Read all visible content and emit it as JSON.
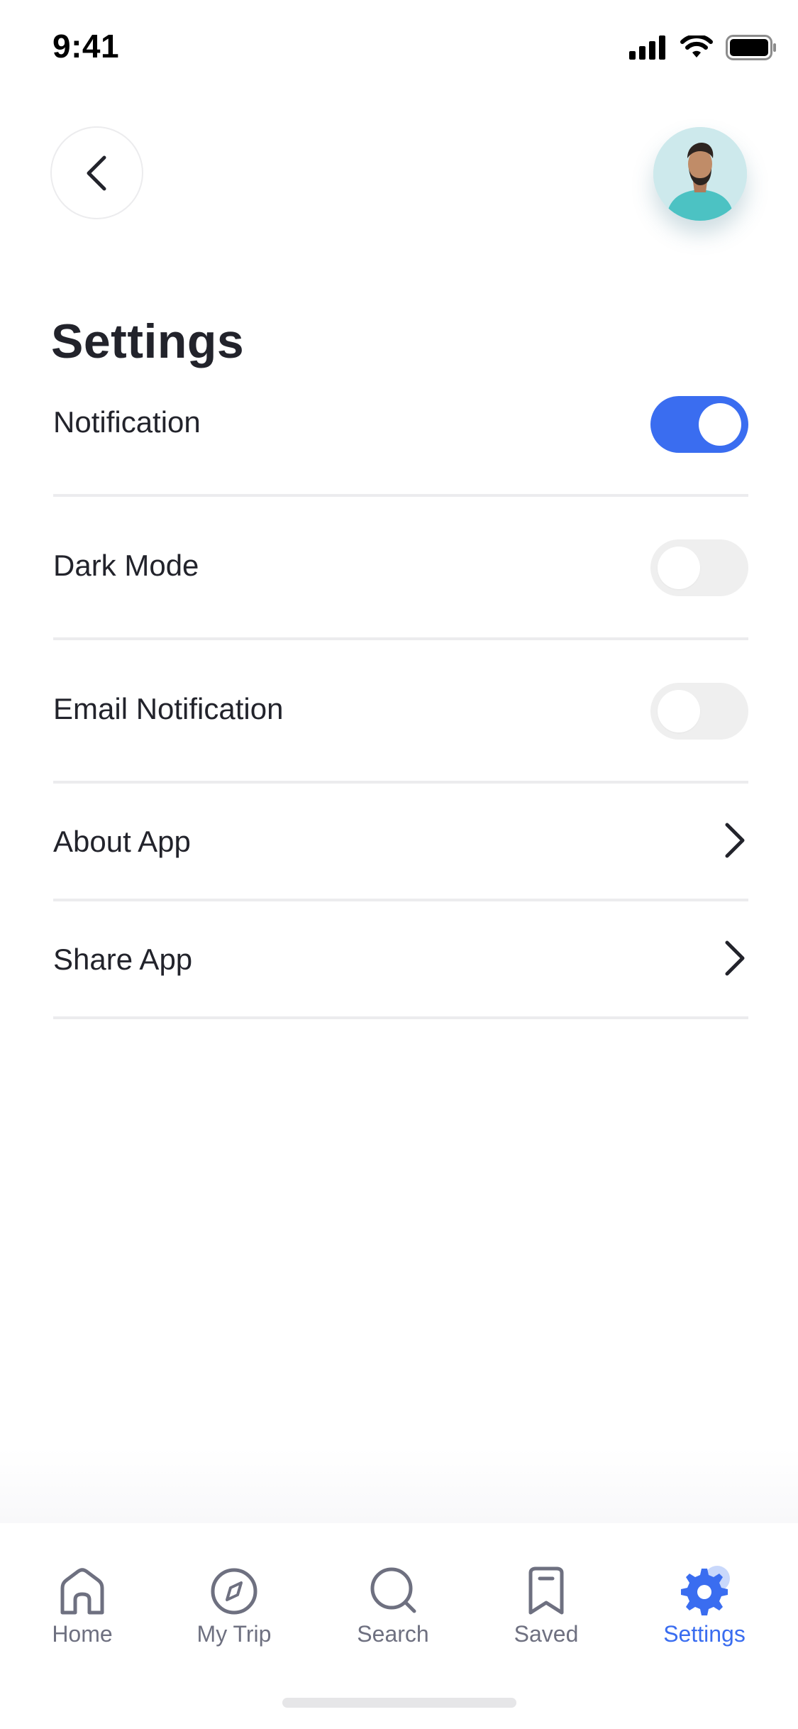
{
  "status_bar": {
    "time": "9:41"
  },
  "header": {
    "back_icon": "chevron-left-icon",
    "avatar": "user-avatar"
  },
  "page": {
    "title": "Settings"
  },
  "settings": {
    "items": [
      {
        "label": "Notification",
        "type": "toggle",
        "enabled": true
      },
      {
        "label": "Dark Mode",
        "type": "toggle",
        "enabled": false
      },
      {
        "label": "Email Notification",
        "type": "toggle",
        "enabled": false
      },
      {
        "label": "About App",
        "type": "link",
        "icon": "chevron-right-icon"
      },
      {
        "label": "Share App",
        "type": "link",
        "icon": "chevron-right-icon"
      }
    ]
  },
  "nav": {
    "items": [
      {
        "label": "Home",
        "icon": "home-icon",
        "active": false
      },
      {
        "label": "My Trip",
        "icon": "compass-icon",
        "active": false
      },
      {
        "label": "Search",
        "icon": "search-icon",
        "active": false
      },
      {
        "label": "Saved",
        "icon": "bookmark-icon",
        "active": false
      },
      {
        "label": "Settings",
        "icon": "gear-icon",
        "active": true
      }
    ]
  },
  "colors": {
    "accent": "#3a6df0",
    "text": "#22232b",
    "muted": "#6e7080",
    "divider": "#ececee",
    "toggle_off": "#efefef"
  }
}
